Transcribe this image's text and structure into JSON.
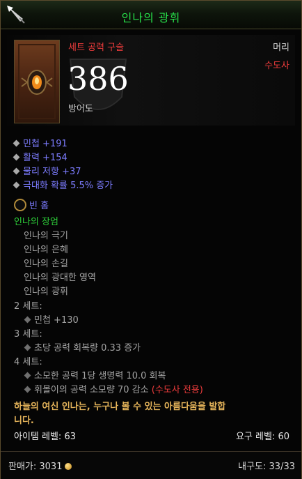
{
  "title": "인나의 광휘",
  "header": {
    "set_label": "세트 공력 구슬",
    "slot": "머리",
    "class": "수도사",
    "armor_value": "386",
    "armor_label": "방어도"
  },
  "stats": [
    "민첩 +191",
    "활력 +154",
    "물리 저항 +37",
    "극대화 확률 5.5% 증가"
  ],
  "socket_label": "빈 홈",
  "set": {
    "name": "인나의 장엄",
    "pieces": [
      "인나의 극기",
      "인나의 은혜",
      "인나의 손길",
      "인나의 광대한 영역",
      "인나의 광휘"
    ],
    "bonuses": [
      {
        "label": "2 세트:",
        "effects": [
          {
            "text": "민첩 +130"
          }
        ]
      },
      {
        "label": "3 세트:",
        "effects": [
          {
            "text": "초당 공력 회복량 0.33 증가"
          }
        ]
      },
      {
        "label": "4 세트:",
        "effects": [
          {
            "text": "소모한 공력 1당 생명력 10.0 회복"
          },
          {
            "text": "휘몰이의 공력 소모량 70 감소 ",
            "note": "(수도사 전용)"
          }
        ]
      }
    ]
  },
  "flavor": [
    "하늘의 여신 인나는, 누구나 볼 수 있는 아름다움을 발합",
    "니다."
  ],
  "item_level": "아이템 레벨: 63",
  "required_level": "요구 레벨: 60",
  "sell_label": "판매가: 3031",
  "durability": "내구도: 33/33",
  "colors": {
    "title": "#27e04a",
    "set": "#2ed23a",
    "magic": "#7c7cff",
    "class": "#ee3c3c",
    "flavor": "#e5b45a"
  },
  "icons": {
    "pin": "quill-pin-icon",
    "socket": "empty-socket-icon",
    "gold": "gold-coin-icon",
    "bullet": "diamond-bullet-icon"
  }
}
